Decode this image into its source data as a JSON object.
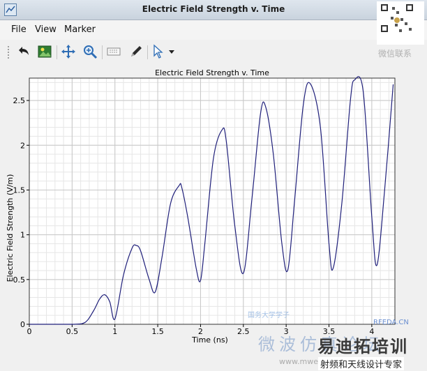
{
  "window": {
    "title": "Electric Field Strength v. Time"
  },
  "menu": [
    "File",
    "View",
    "Marker"
  ],
  "toolbar": {
    "icons": [
      "back-arrow-icon",
      "image-icon",
      "pan-icon",
      "zoom-icon",
      "keyboard-icon",
      "pen-icon",
      "pointer-icon",
      "dropdown-arrow-icon"
    ]
  },
  "colors": {
    "curve": "#1f1f7a",
    "grid_major": "#c8c8c8",
    "grid_minor": "#e6e6e6"
  },
  "chart_data": {
    "type": "line",
    "title": "Electric Field Strength v. Time",
    "xlabel": "Time (ns)",
    "ylabel": "Electric Field Strength (V/m)",
    "xlim": [
      0,
      4.27
    ],
    "ylim": [
      0,
      2.75
    ],
    "xticks": [
      "0",
      "0.5",
      "1",
      "1.5",
      "2",
      "2.5",
      "3",
      "3.5",
      "4"
    ],
    "yticks": [
      "0",
      "0.5",
      "1",
      "1.5",
      "2",
      "2.5"
    ],
    "grid": true,
    "series": [
      {
        "x": [
          0,
          0.5,
          0.65,
          0.75,
          0.82,
          0.88,
          0.94,
          1.0,
          1.1,
          1.2,
          1.25,
          1.3,
          1.4,
          1.47,
          1.55,
          1.65,
          1.75,
          1.78,
          1.85,
          1.95,
          2.0,
          2.05,
          2.15,
          2.25,
          2.3,
          2.4,
          2.5,
          2.6,
          2.7,
          2.76,
          2.85,
          2.95,
          3.02,
          3.1,
          3.2,
          3.28,
          3.4,
          3.5,
          3.55,
          3.65,
          3.75,
          3.8,
          3.9,
          4.0,
          4.06,
          4.15,
          4.25
        ],
        "y": [
          0,
          0,
          0.02,
          0.15,
          0.28,
          0.33,
          0.25,
          0.06,
          0.55,
          0.85,
          0.88,
          0.82,
          0.5,
          0.36,
          0.75,
          1.35,
          1.55,
          1.53,
          1.2,
          0.62,
          0.49,
          0.9,
          1.85,
          2.17,
          2.05,
          1.1,
          0.57,
          1.4,
          2.35,
          2.43,
          1.9,
          0.9,
          0.61,
          1.4,
          2.45,
          2.69,
          2.2,
          0.9,
          0.63,
          1.35,
          2.5,
          2.73,
          2.6,
          1.2,
          0.66,
          1.5,
          2.68
        ]
      }
    ]
  },
  "watermarks": {
    "wechat_label": "微信联系",
    "line1": "国务大学学子",
    "line2": "微波仿真论坛",
    "line3": "射频和天线设计专家",
    "brand": "RFEDA.CN",
    "site": "www.mweda.com"
  }
}
